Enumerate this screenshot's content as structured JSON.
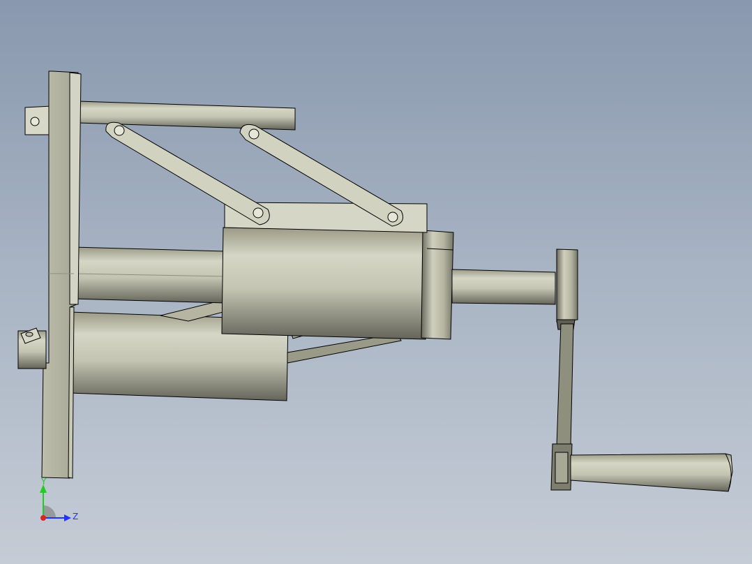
{
  "viewport": {
    "background_top": "#8998ae",
    "background_bottom": "#c5ccd6"
  },
  "model": {
    "body_color": "#c9c9b8",
    "shadow_color": "#6e6e60",
    "edge_color": "#000000"
  },
  "triad": {
    "y_label": "Y",
    "z_label": "Z",
    "y_color": "#22cc22",
    "z_color": "#2233ff",
    "x_color": "#dd2222"
  }
}
